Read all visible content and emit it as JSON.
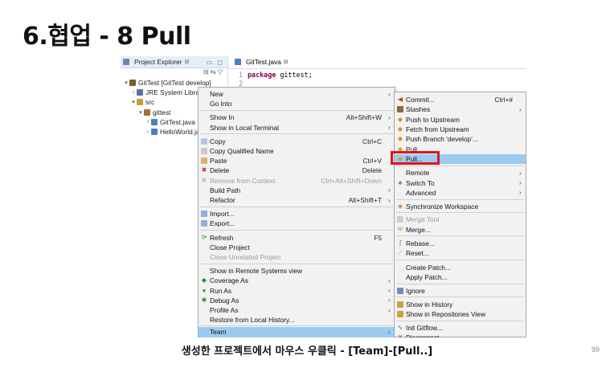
{
  "slide": {
    "title": "6.협업 - 8 Pull",
    "caption": "생성한 프로젝트에서 마우스 우클릭 - [Team]-[Pull..]",
    "page_number": "99"
  },
  "explorer": {
    "tab_label": "Project Explorer",
    "tab_close": "⊠",
    "tab_buttons": "▭ ◻",
    "toolbar_icons": "⊟ ⇆ ▽",
    "tree": [
      {
        "label": "GitTest [GitTest develop]",
        "twisty": "▾",
        "depth": 0,
        "icon_color": "#7a5c2e"
      },
      {
        "label": "JRE System Library",
        "twisty": "›",
        "depth": 1,
        "icon_color": "#5a6fa8"
      },
      {
        "label": "src",
        "twisty": "▾",
        "depth": 1,
        "icon_color": "#c89b3c"
      },
      {
        "label": "gittest",
        "twisty": "▾",
        "depth": 2,
        "icon_color": "#a0703a"
      },
      {
        "label": "GitTest.java",
        "twisty": "›",
        "depth": 3,
        "icon_color": "#4a7fc1"
      },
      {
        "label": "HelloWorld.java",
        "twisty": "›",
        "depth": 3,
        "icon_color": "#4a7fc1"
      }
    ]
  },
  "editor": {
    "tab_label": "GitTest.java",
    "tab_close": "⊠",
    "lines": [
      {
        "num": "1",
        "keyword": "package",
        "text": " gittest;"
      },
      {
        "num": "2",
        "keyword": "",
        "text": ""
      }
    ]
  },
  "context_menu": {
    "items": [
      {
        "label": "New",
        "shortcut": "",
        "arrow": "›",
        "icon": "",
        "state": "normal"
      },
      {
        "label": "Go Into",
        "shortcut": "",
        "arrow": "",
        "icon": "",
        "state": "normal"
      },
      {
        "label": "Show In",
        "shortcut": "Alt+Shift+W",
        "arrow": "›",
        "icon": "",
        "state": "normal"
      },
      {
        "label": "Show in Local Terminal",
        "shortcut": "",
        "arrow": "›",
        "icon": "",
        "state": "normal"
      },
      {
        "label": "Copy",
        "shortcut": "Ctrl+C",
        "arrow": "",
        "icon": "copy-icon",
        "state": "normal"
      },
      {
        "label": "Copy Qualified Name",
        "shortcut": "",
        "arrow": "",
        "icon": "copy-qualified-icon",
        "state": "normal"
      },
      {
        "label": "Paste",
        "shortcut": "Ctrl+V",
        "arrow": "",
        "icon": "paste-icon",
        "state": "normal"
      },
      {
        "label": "Delete",
        "shortcut": "Delete",
        "arrow": "",
        "icon": "delete-icon",
        "state": "normal"
      },
      {
        "label": "Remove from Context",
        "shortcut": "Ctrl+Alt+Shift+Down",
        "arrow": "",
        "icon": "remove-context-icon",
        "state": "disabled"
      },
      {
        "label": "Build Path",
        "shortcut": "",
        "arrow": "›",
        "icon": "",
        "state": "normal"
      },
      {
        "label": "Refactor",
        "shortcut": "Alt+Shift+T",
        "arrow": "›",
        "icon": "",
        "state": "normal"
      },
      {
        "label": "Import...",
        "shortcut": "",
        "arrow": "",
        "icon": "import-icon",
        "state": "normal"
      },
      {
        "label": "Export...",
        "shortcut": "",
        "arrow": "",
        "icon": "export-icon",
        "state": "normal"
      },
      {
        "label": "Refresh",
        "shortcut": "F5",
        "arrow": "",
        "icon": "refresh-icon",
        "state": "normal"
      },
      {
        "label": "Close Project",
        "shortcut": "",
        "arrow": "",
        "icon": "",
        "state": "normal"
      },
      {
        "label": "Close Unrelated Project",
        "shortcut": "",
        "arrow": "",
        "icon": "",
        "state": "disabled"
      },
      {
        "label": "Show in Remote Systems view",
        "shortcut": "",
        "arrow": "",
        "icon": "",
        "state": "normal"
      },
      {
        "label": "Coverage As",
        "shortcut": "",
        "arrow": "›",
        "icon": "coverage-icon",
        "state": "normal"
      },
      {
        "label": "Run As",
        "shortcut": "",
        "arrow": "›",
        "icon": "run-icon",
        "state": "normal"
      },
      {
        "label": "Debug As",
        "shortcut": "",
        "arrow": "›",
        "icon": "debug-icon",
        "state": "normal"
      },
      {
        "label": "Profile As",
        "shortcut": "",
        "arrow": "›",
        "icon": "",
        "state": "normal"
      },
      {
        "label": "Restore from Local History...",
        "shortcut": "",
        "arrow": "",
        "icon": "",
        "state": "normal"
      },
      {
        "label": "Team",
        "shortcut": "",
        "arrow": "›",
        "icon": "",
        "state": "highlighted"
      }
    ]
  },
  "team_menu": {
    "items": [
      {
        "label": "Commit...",
        "shortcut": "Ctrl+#",
        "arrow": "",
        "icon": "commit-icon",
        "state": "normal"
      },
      {
        "label": "Stashes",
        "shortcut": "",
        "arrow": "›",
        "icon": "stashes-icon",
        "state": "normal"
      },
      {
        "label": "Push to Upstream",
        "shortcut": "",
        "arrow": "",
        "icon": "push-upstream-icon",
        "state": "normal"
      },
      {
        "label": "Fetch from Upstream",
        "shortcut": "",
        "arrow": "",
        "icon": "fetch-upstream-icon",
        "state": "normal"
      },
      {
        "label": "Push Branch 'develop'...",
        "shortcut": "",
        "arrow": "",
        "icon": "push-branch-icon",
        "state": "normal"
      },
      {
        "label": "Pull",
        "shortcut": "",
        "arrow": "",
        "icon": "pull-icon",
        "state": "normal"
      },
      {
        "label": "Pull...",
        "shortcut": "",
        "arrow": "",
        "icon": "pull-dialog-icon",
        "state": "highlighted"
      },
      {
        "label": "Remote",
        "shortcut": "",
        "arrow": "›",
        "icon": "",
        "state": "normal"
      },
      {
        "label": "Switch To",
        "shortcut": "",
        "arrow": "›",
        "icon": "switch-to-icon",
        "state": "normal"
      },
      {
        "label": "Advanced",
        "shortcut": "",
        "arrow": "›",
        "icon": "",
        "state": "normal"
      },
      {
        "label": "Synchronize Workspace",
        "shortcut": "",
        "arrow": "",
        "icon": "synchronize-icon",
        "state": "normal"
      },
      {
        "label": "Merge Tool",
        "shortcut": "",
        "arrow": "",
        "icon": "merge-tool-icon",
        "state": "disabled"
      },
      {
        "label": "Merge...",
        "shortcut": "",
        "arrow": "",
        "icon": "merge-icon",
        "state": "normal"
      },
      {
        "label": "Rebase...",
        "shortcut": "",
        "arrow": "",
        "icon": "rebase-icon",
        "state": "normal"
      },
      {
        "label": "Reset...",
        "shortcut": "",
        "arrow": "",
        "icon": "reset-icon",
        "state": "normal"
      },
      {
        "label": "Create Patch...",
        "shortcut": "",
        "arrow": "",
        "icon": "",
        "state": "normal"
      },
      {
        "label": "Apply Patch...",
        "shortcut": "",
        "arrow": "",
        "icon": "",
        "state": "normal"
      },
      {
        "label": "Ignore",
        "shortcut": "",
        "arrow": "",
        "icon": "ignore-icon",
        "state": "normal"
      },
      {
        "label": "Show in History",
        "shortcut": "",
        "arrow": "",
        "icon": "history-icon",
        "state": "normal"
      },
      {
        "label": "Show in Repositories View",
        "shortcut": "",
        "arrow": "",
        "icon": "repositories-icon",
        "state": "normal"
      },
      {
        "label": "Init Gitflow...",
        "shortcut": "",
        "arrow": "",
        "icon": "gitflow-icon",
        "state": "normal"
      },
      {
        "label": "Disconnect",
        "shortcut": "",
        "arrow": "",
        "icon": "disconnect-icon",
        "state": "normal"
      }
    ]
  },
  "colors": {
    "highlight": "#9ccbf2",
    "callout_red": "#e0141e",
    "menu_bg": "#f2f2f2",
    "keyword": "#7f0055"
  }
}
